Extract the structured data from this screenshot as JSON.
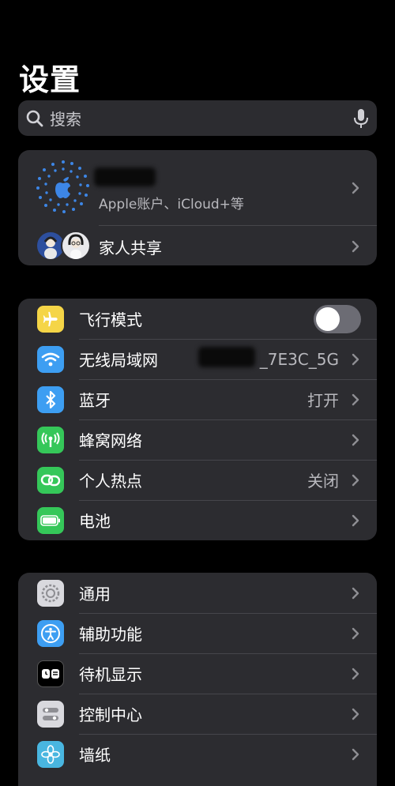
{
  "header": {
    "title": "设置"
  },
  "search": {
    "placeholder": "搜索"
  },
  "account": {
    "subtitle": "Apple账户、iCloud+等",
    "family_label": "家人共享"
  },
  "connectivity": {
    "items": [
      {
        "label": "飞行模式",
        "value": "",
        "icon": "airplane-icon",
        "color": "#f5d547",
        "toggle_on": false
      },
      {
        "label": "无线局域网",
        "value": "_7E3C_5G",
        "icon": "wifi-icon",
        "color": "#3d9ef2"
      },
      {
        "label": "蓝牙",
        "value": "打开",
        "icon": "bluetooth-icon",
        "color": "#3d9ef2"
      },
      {
        "label": "蜂窝网络",
        "value": "",
        "icon": "cellular-icon",
        "color": "#35c759"
      },
      {
        "label": "个人热点",
        "value": "关闭",
        "icon": "hotspot-icon",
        "color": "#35c759"
      },
      {
        "label": "电池",
        "value": "",
        "icon": "battery-icon",
        "color": "#35c759"
      }
    ]
  },
  "general": {
    "items": [
      {
        "label": "通用",
        "icon": "gear-icon",
        "color": "#d9d9de"
      },
      {
        "label": "辅助功能",
        "icon": "accessibility-icon",
        "color": "#3d9ef2"
      },
      {
        "label": "待机显示",
        "icon": "standby-icon",
        "color": "#000000"
      },
      {
        "label": "控制中心",
        "icon": "control-center-icon",
        "color": "#d9d9de"
      },
      {
        "label": "墙纸",
        "icon": "wallpaper-icon",
        "color": "#49b6e0"
      }
    ]
  }
}
